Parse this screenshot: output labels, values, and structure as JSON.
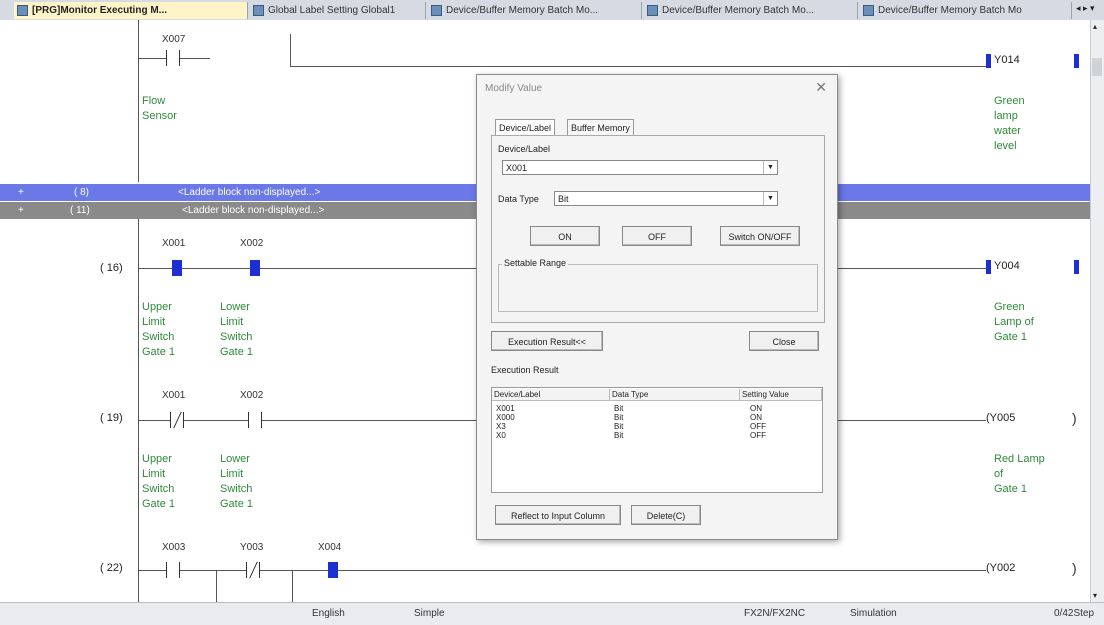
{
  "tabs": [
    {
      "label": "[PRG]Monitor Executing M...",
      "active": true
    },
    {
      "label": "Global Label Setting Global1",
      "active": false
    },
    {
      "label": "Device/Buffer Memory Batch Mo...",
      "active": false
    },
    {
      "label": "Device/Buffer Memory Batch Mo...",
      "active": false
    },
    {
      "label": "Device/Buffer Memory Batch Mo",
      "active": false
    }
  ],
  "ladder": {
    "rung0": {
      "contact": "X007",
      "comment": [
        "Flow",
        "Sensor"
      ],
      "coil": "Y014",
      "coil_comment": [
        "Green",
        "lamp",
        "water",
        "level"
      ]
    },
    "block1": {
      "step": "( 8)",
      "text": "<Ladder block non-displayed...>"
    },
    "block2": {
      "step": "( 11)",
      "text": "<Ladder block non-displayed...>"
    },
    "rung16": {
      "step": "( 16)",
      "contact1": "X001",
      "contact2": "X002",
      "coil": "Y004",
      "comment1": [
        "Upper",
        "Limit",
        "Switch",
        "Gate 1"
      ],
      "comment2": [
        "Lower",
        "Limit",
        "Switch",
        "Gate 1"
      ],
      "coil_comment": [
        "Green",
        "Lamp of",
        "Gate 1"
      ]
    },
    "rung19": {
      "step": "( 19)",
      "contact1": "X001",
      "contact2": "X002",
      "coil": "Y005",
      "comment1": [
        "Upper",
        "Limit",
        "Switch",
        "Gate 1"
      ],
      "comment2": [
        "Lower",
        "Limit",
        "Switch",
        "Gate 1"
      ],
      "coil_comment": [
        "Red Lamp",
        "of",
        "Gate 1"
      ]
    },
    "rung22": {
      "step": "( 22)",
      "contact1": "X003",
      "contact2": "Y003",
      "contact3": "X004",
      "coil": "Y002"
    }
  },
  "dialog": {
    "title": "Modify Value",
    "close": "✕",
    "tab_device": "Device/Label",
    "tab_buffer": "Buffer Memory",
    "device_label": "Device/Label",
    "device_value": "X001",
    "datatype_label": "Data Type",
    "datatype_value": "Bit",
    "btn_on": "ON",
    "btn_off": "OFF",
    "btn_switch": "Switch ON/OFF",
    "settable_range": "Settable Range",
    "btn_exec_result": "Execution Result<<",
    "btn_close": "Close",
    "exec_result_label": "Execution Result",
    "table_headers": [
      "Device/Label",
      "Data Type",
      "Setting Value"
    ],
    "table_rows": [
      [
        "X001",
        "Bit",
        "ON"
      ],
      [
        "X000",
        "Bit",
        "ON"
      ],
      [
        "X3",
        "Bit",
        "OFF"
      ],
      [
        "X0",
        "Bit",
        "OFF"
      ]
    ],
    "btn_reflect": "Reflect to Input Column",
    "btn_delete": "Delete(C)"
  },
  "status": {
    "language": "English",
    "mode": "Simple",
    "cpu": "FX2N/FX2NC",
    "state": "Simulation",
    "steps": "0/42Step"
  },
  "colors": {
    "selected_bar": "#6a78e8",
    "grey_bar": "#8a8a8a",
    "contact_on": "#1c2fd0",
    "comment": "#2e8b3a"
  }
}
